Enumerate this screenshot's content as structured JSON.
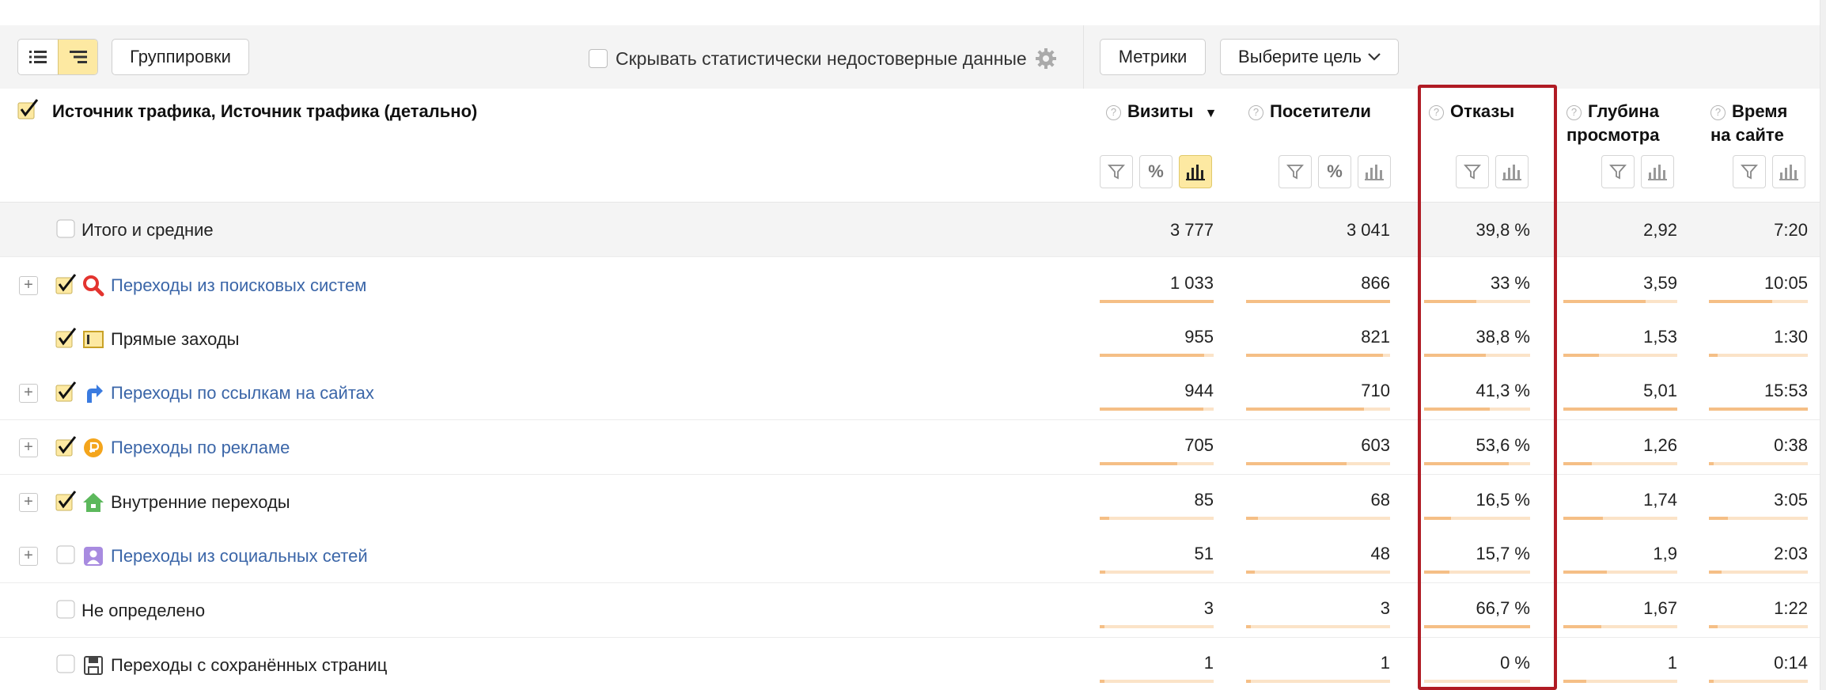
{
  "toolbar": {
    "groupings_label": "Группировки",
    "hide_unreliable_label": "Скрывать статистически недостоверные данные",
    "metrics_label": "Метрики",
    "goal_select_label": "Выберите цель"
  },
  "header": {
    "dimension_title": "Источник трафика, Источник трафика (детально)",
    "columns": [
      {
        "line1": "Визиты",
        "line2": "",
        "sort": "▼"
      },
      {
        "line1": "Посетители",
        "line2": ""
      },
      {
        "line1": "Отказы",
        "line2": ""
      },
      {
        "line1": "Глубина",
        "line2": "просмотра"
      },
      {
        "line1": "Время",
        "line2": "на сайте"
      }
    ],
    "help_glyph": "?",
    "percent_glyph": "%"
  },
  "rows": [
    {
      "label": "Итого и средние",
      "icon": "none",
      "visits": "3 777",
      "visitors": "3 041",
      "bounce": "39,8 %",
      "depth": "2,92",
      "time": "7:20"
    },
    {
      "label": "Переходы из поисковых систем",
      "icon": "search-engine-icon",
      "visits": "1 033",
      "visitors": "866",
      "bounce": "33 %",
      "depth": "3,59",
      "time": "10:05"
    },
    {
      "label": "Прямые заходы",
      "icon": "direct-visit-icon",
      "visits": "955",
      "visitors": "821",
      "bounce": "38,8 %",
      "depth": "1,53",
      "time": "1:30"
    },
    {
      "label": "Переходы по ссылкам на сайтах",
      "icon": "link-arrow-icon",
      "visits": "944",
      "visitors": "710",
      "bounce": "41,3 %",
      "depth": "5,01",
      "time": "15:53"
    },
    {
      "label": "Переходы по рекламе",
      "icon": "ad-coin-icon",
      "visits": "705",
      "visitors": "603",
      "bounce": "53,6 %",
      "depth": "1,26",
      "time": "0:38"
    },
    {
      "label": "Внутренние переходы",
      "icon": "internal-home-icon",
      "visits": "85",
      "visitors": "68",
      "bounce": "16,5 %",
      "depth": "1,74",
      "time": "3:05"
    },
    {
      "label": "Переходы из социальных сетей",
      "icon": "social-user-icon",
      "visits": "51",
      "visitors": "48",
      "bounce": "15,7 %",
      "depth": "1,9",
      "time": "2:03"
    },
    {
      "label": "Не определено",
      "icon": "none",
      "visits": "3",
      "visitors": "3",
      "bounce": "66,7 %",
      "depth": "1,67",
      "time": "1:22"
    },
    {
      "label": "Переходы с сохранённых страниц",
      "icon": "floppy-disk-icon",
      "visits": "1",
      "visitors": "1",
      "bounce": "0 %",
      "depth": "1",
      "time": "0:14"
    }
  ],
  "bar_fractions": {
    "visits": [
      0,
      1.0,
      0.92,
      0.91,
      0.68,
      0.08,
      0.05,
      0.01,
      0.01
    ],
    "visitors": [
      0,
      1.0,
      0.95,
      0.82,
      0.7,
      0.08,
      0.06,
      0.01,
      0.01
    ],
    "bounce": [
      0,
      0.49,
      0.58,
      0.62,
      0.8,
      0.25,
      0.24,
      1.0,
      0.0
    ],
    "depth": [
      0,
      0.72,
      0.31,
      1.0,
      0.25,
      0.35,
      0.38,
      0.33,
      0.2
    ],
    "time": [
      0,
      0.64,
      0.09,
      1.0,
      0.04,
      0.19,
      0.13,
      0.09,
      0.02
    ]
  },
  "colors": {
    "accent_yellow": "#fde9a2",
    "link": "#3b66a8",
    "bar": "#f5bf86",
    "bar_track": "#fbe3c8",
    "highlight": "#b01b24"
  }
}
